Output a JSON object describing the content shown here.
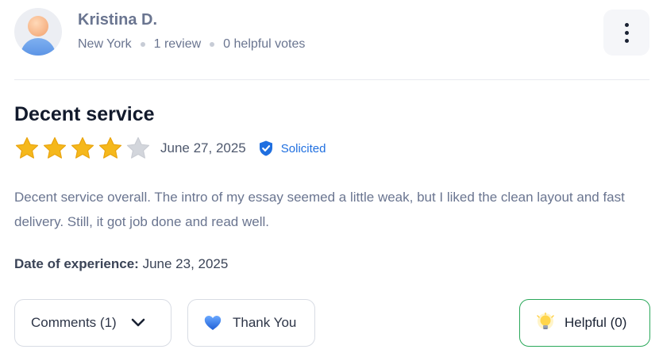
{
  "reviewer": {
    "name": "Kristina D.",
    "location": "New York",
    "reviews": "1 review",
    "helpful_votes": "0 helpful votes"
  },
  "review": {
    "title": "Decent service",
    "rating": 4,
    "rating_max": 5,
    "date": "June 27, 2025",
    "badge": "Solicited",
    "text": "Decent service overall. The intro of my essay seemed a little weak, but I liked the clean layout and fast delivery. Still, it got job done and read well.",
    "experience_label": "Date of experience:",
    "experience_date": "June 23, 2025"
  },
  "actions": {
    "comments": "Comments (1)",
    "thank_you": "Thank You",
    "helpful": "Helpful (0)"
  },
  "colors": {
    "star_filled": "#f5b81c",
    "star_empty": "#d3d6dc",
    "accent_blue": "#1f6fe0",
    "helpful_border": "#2aa85a"
  }
}
